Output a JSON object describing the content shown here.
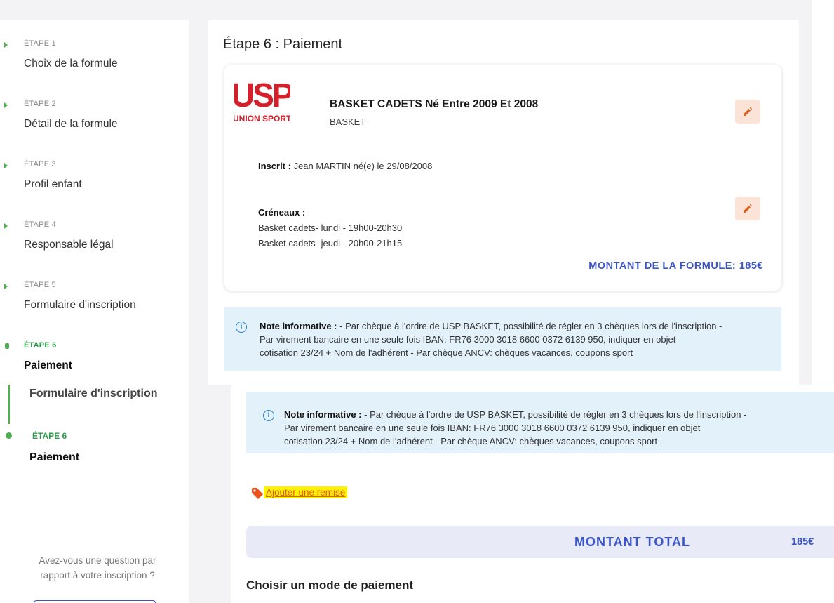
{
  "sidebar": {
    "steps": [
      {
        "label": "ÉTAPE 1",
        "title": "Choix de la formule"
      },
      {
        "label": "ÉTAPE 2",
        "title": "Détail de la formule"
      },
      {
        "label": "ÉTAPE 3",
        "title": "Profil enfant"
      },
      {
        "label": "ÉTAPE 4",
        "title": "Responsable légal"
      },
      {
        "label": "ÉTAPE 5",
        "title": "Formulaire d'inscription"
      },
      {
        "label": "ÉTAPE 6",
        "title": "Paiement"
      }
    ],
    "question": "Avez-vous une question par rapport à votre inscription ?"
  },
  "main": {
    "title": "Étape 6 : Paiement",
    "formula": {
      "logo_text": "USPt",
      "logo_subtext": "UNION SPORTIVE",
      "name": "BASKET CADETS Né Entre 2009 Et 2008",
      "sport": "BASKET",
      "inscrit_label": "Inscrit :",
      "inscrit_value": " Jean MARTIN né(e) le 29/08/2008",
      "creneaux_label": "Créneaux :",
      "creneaux": [
        "Basket cadets- lundi - 19h00-20h30",
        "Basket cadets- jeudi - 20h00-21h15"
      ],
      "montant": "MONTANT DE LA FORMULE: 185€"
    },
    "note": {
      "label": "Note informative :",
      "line1": " - Par chèque à l'ordre de USP BASKET, possibilité de régler en 3 chèques lors de l'inscription -",
      "line2": "Par virement bancaire en une seule fois IBAN: FR76 3000 3018 6600 0372 6139 950, indiquer en objet",
      "line3": "cotisation 23/24 + Nom de l'adhérent - Par chèque ANCV: chèques vacances, coupons sport"
    },
    "remise_link": "Ajouter une remise",
    "total_label": "MONTANT TOTAL",
    "total_value": "185€",
    "choose_mode": "Choisir un mode de paiement"
  },
  "colors": {
    "accent": "#3b55c9",
    "success": "#4caf50",
    "edit_bg": "#fbe3d8",
    "edit_icon": "#e0601f",
    "note_bg": "#e3f1fb",
    "highlight": "#fff200"
  },
  "icons": [
    "chevron-right-icon",
    "pencil-icon",
    "info-icon",
    "tag-icon"
  ]
}
